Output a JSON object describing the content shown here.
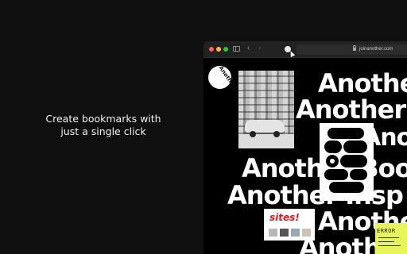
{
  "promo": {
    "line1": "Create bookmarks with",
    "line2": "just a single click"
  },
  "browser": {
    "url": "joinanother.com",
    "icons": [
      "sidebar-icon",
      "back-icon",
      "forward-icon",
      "extension-icon",
      "lock-icon"
    ],
    "traffic_light_colors": [
      "#ff5f57",
      "#febc2e",
      "#28c840"
    ]
  },
  "website": {
    "logo_text": "Another",
    "headlines": [
      "Another",
      "Another",
      "Anoth",
      "Another Boo",
      "Another Insp",
      "Another",
      "Another"
    ],
    "sticker_text": "sites!",
    "error_label": "ERROR"
  },
  "colors": {
    "background": "#0f0f0f",
    "sticker_red": "#e2191b",
    "note_yellow": "#e8f55a"
  }
}
